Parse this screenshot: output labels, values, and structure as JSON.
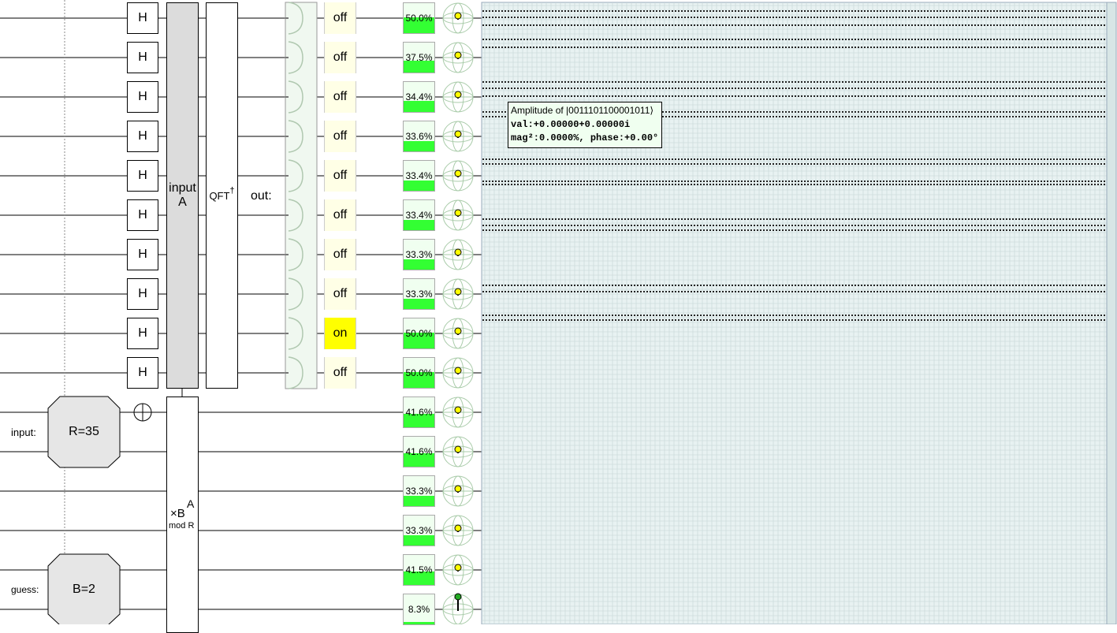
{
  "gates": {
    "hadamard_label": "H",
    "input_a": [
      "input",
      "A"
    ],
    "qft_inverse": "QFT",
    "qft_dagger": "†",
    "out_label": "out:",
    "input_label": "input:",
    "guess_label": "guess:",
    "r_gate": "R=35",
    "b_gate": "B=2",
    "mult": {
      "main": "×B",
      "sup": "A",
      "sub": "mod R"
    }
  },
  "pad_states": [
    "off",
    "off",
    "off",
    "off",
    "off",
    "off",
    "off",
    "off",
    "on",
    "off"
  ],
  "probabilities": [
    {
      "label": "50.0%",
      "value": 0.5
    },
    {
      "label": "37.5%",
      "value": 0.375
    },
    {
      "label": "34.4%",
      "value": 0.344
    },
    {
      "label": "33.6%",
      "value": 0.336
    },
    {
      "label": "33.4%",
      "value": 0.334
    },
    {
      "label": "33.4%",
      "value": 0.334
    },
    {
      "label": "33.3%",
      "value": 0.333
    },
    {
      "label": "33.3%",
      "value": 0.333
    },
    {
      "label": "50.0%",
      "value": 0.5
    },
    {
      "label": "50.0%",
      "value": 0.5
    },
    {
      "label": "41.6%",
      "value": 0.416
    },
    {
      "label": "41.6%",
      "value": 0.416
    },
    {
      "label": "33.3%",
      "value": 0.333
    },
    {
      "label": "33.3%",
      "value": 0.333
    },
    {
      "label": "41.5%",
      "value": 0.415
    },
    {
      "label": "8.3%",
      "value": 0.083
    }
  ],
  "tooltip": {
    "title": "Amplitude of |0011101100001011⟩",
    "val": "val:+0.00000+0.00000i",
    "mag": "mag²:0.0000%, phase:+0.00°"
  },
  "colors": {
    "wire": "#000000",
    "prob_fill": "#33ff33",
    "prob_bg": "#f0fff0",
    "pad_on": "#ffff00",
    "pad_off": "#ffffe6",
    "grid_bg": "#e8f2f2",
    "gate_gray": "#dcdcdc"
  }
}
